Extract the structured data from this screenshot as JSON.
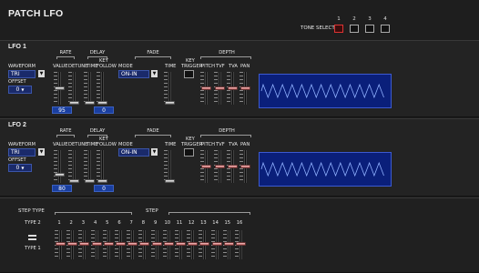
{
  "page": {
    "title": "PATCH LFO"
  },
  "tone_select": {
    "label": "TONE SELECT",
    "tones": [
      "1",
      "2",
      "3",
      "4"
    ],
    "active": 1
  },
  "lfo1": {
    "name": "LFO 1",
    "labels": {
      "waveform": "WAVEFORM",
      "offset": "OFFSET",
      "rate": "RATE",
      "delay": "DELAY",
      "fade": "FADE",
      "depth": "DEPTH",
      "value": "VALUE",
      "detune": "DETUNE",
      "time": "TIME",
      "key": "KEY",
      "follow": "FOLLOW",
      "mode": "MODE",
      "fade_time": "TIME",
      "trigger": "TRIGGER",
      "pitch": "PITCH",
      "tvf": "TVF",
      "tva": "TVA",
      "pan": "PAN"
    },
    "waveform": "TRI",
    "offset": "0",
    "fade_mode": "ON-IN",
    "rate_value": "95",
    "delay_key_follow": "0",
    "wave_color": "#8fb0ff"
  },
  "lfo2": {
    "name": "LFO 2",
    "labels": {
      "waveform": "WAVEFORM",
      "offset": "OFFSET",
      "rate": "RATE",
      "delay": "DELAY",
      "fade": "FADE",
      "depth": "DEPTH",
      "value": "VALUE",
      "detune": "DETUNE",
      "time": "TIME",
      "key": "KEY",
      "follow": "FOLLOW",
      "mode": "MODE",
      "fade_time": "TIME",
      "trigger": "TRIGGER",
      "pitch": "PITCH",
      "tvf": "TVF",
      "tva": "TVA",
      "pan": "PAN"
    },
    "waveform": "TRI",
    "offset": "0",
    "fade_mode": "ON-IN",
    "rate_value": "80",
    "delay_key_follow": "0",
    "wave_color": "#8fb0ff"
  },
  "step": {
    "step_type_label": "STEP TYPE",
    "step_label": "STEP",
    "type2": "TYPE 2",
    "type1": "TYPE 1",
    "numbers": [
      "1",
      "2",
      "3",
      "4",
      "5",
      "6",
      "7",
      "8",
      "9",
      "10",
      "11",
      "12",
      "13",
      "14",
      "15",
      "16"
    ]
  },
  "colors": {
    "accent": "#1a3fa0",
    "tone_active": "#cc3333"
  }
}
